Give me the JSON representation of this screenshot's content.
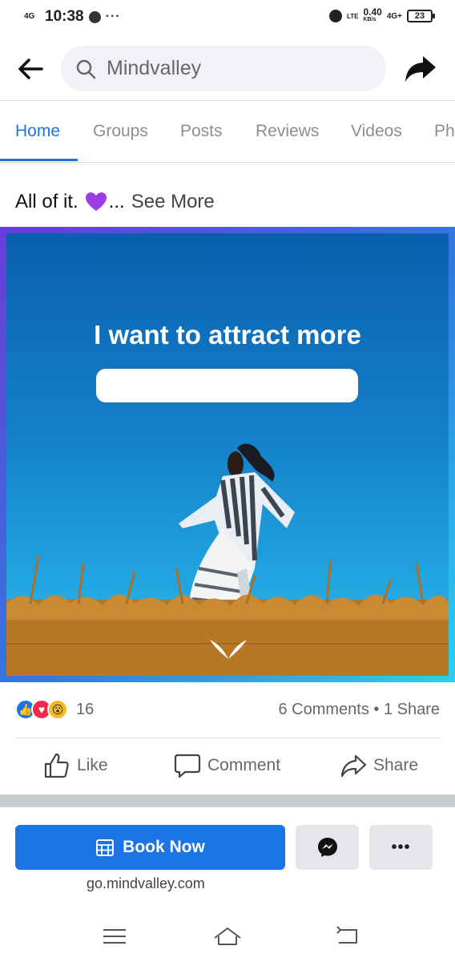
{
  "status_bar": {
    "network": "4G",
    "time": "10:38",
    "lte": "LTE",
    "speed": "0.40",
    "speed_unit": "KB/s",
    "network2": "4G+",
    "battery": "23"
  },
  "header": {
    "search_placeholder": "Mindvalley"
  },
  "tabs": [
    {
      "label": "Home",
      "active": true
    },
    {
      "label": "Groups",
      "active": false
    },
    {
      "label": "Posts",
      "active": false
    },
    {
      "label": "Reviews",
      "active": false
    },
    {
      "label": "Videos",
      "active": false
    },
    {
      "label": "Ph",
      "active": false
    }
  ],
  "post": {
    "text": "All of it.",
    "ellipsis": "...",
    "see_more": "See More",
    "ad_headline": "I want to attract more"
  },
  "engagement": {
    "reaction_count": "16",
    "comments_shares": "6 Comments • 1 Share"
  },
  "actions": {
    "like": "Like",
    "comment": "Comment",
    "share": "Share"
  },
  "cta": {
    "button_label": "Book Now",
    "more_label": "•••",
    "url": "go.mindvalley.com"
  },
  "colors": {
    "accent": "#1b74e4",
    "cta_bg": "#1b74e4",
    "secondary_btn": "#e4e6eb"
  }
}
